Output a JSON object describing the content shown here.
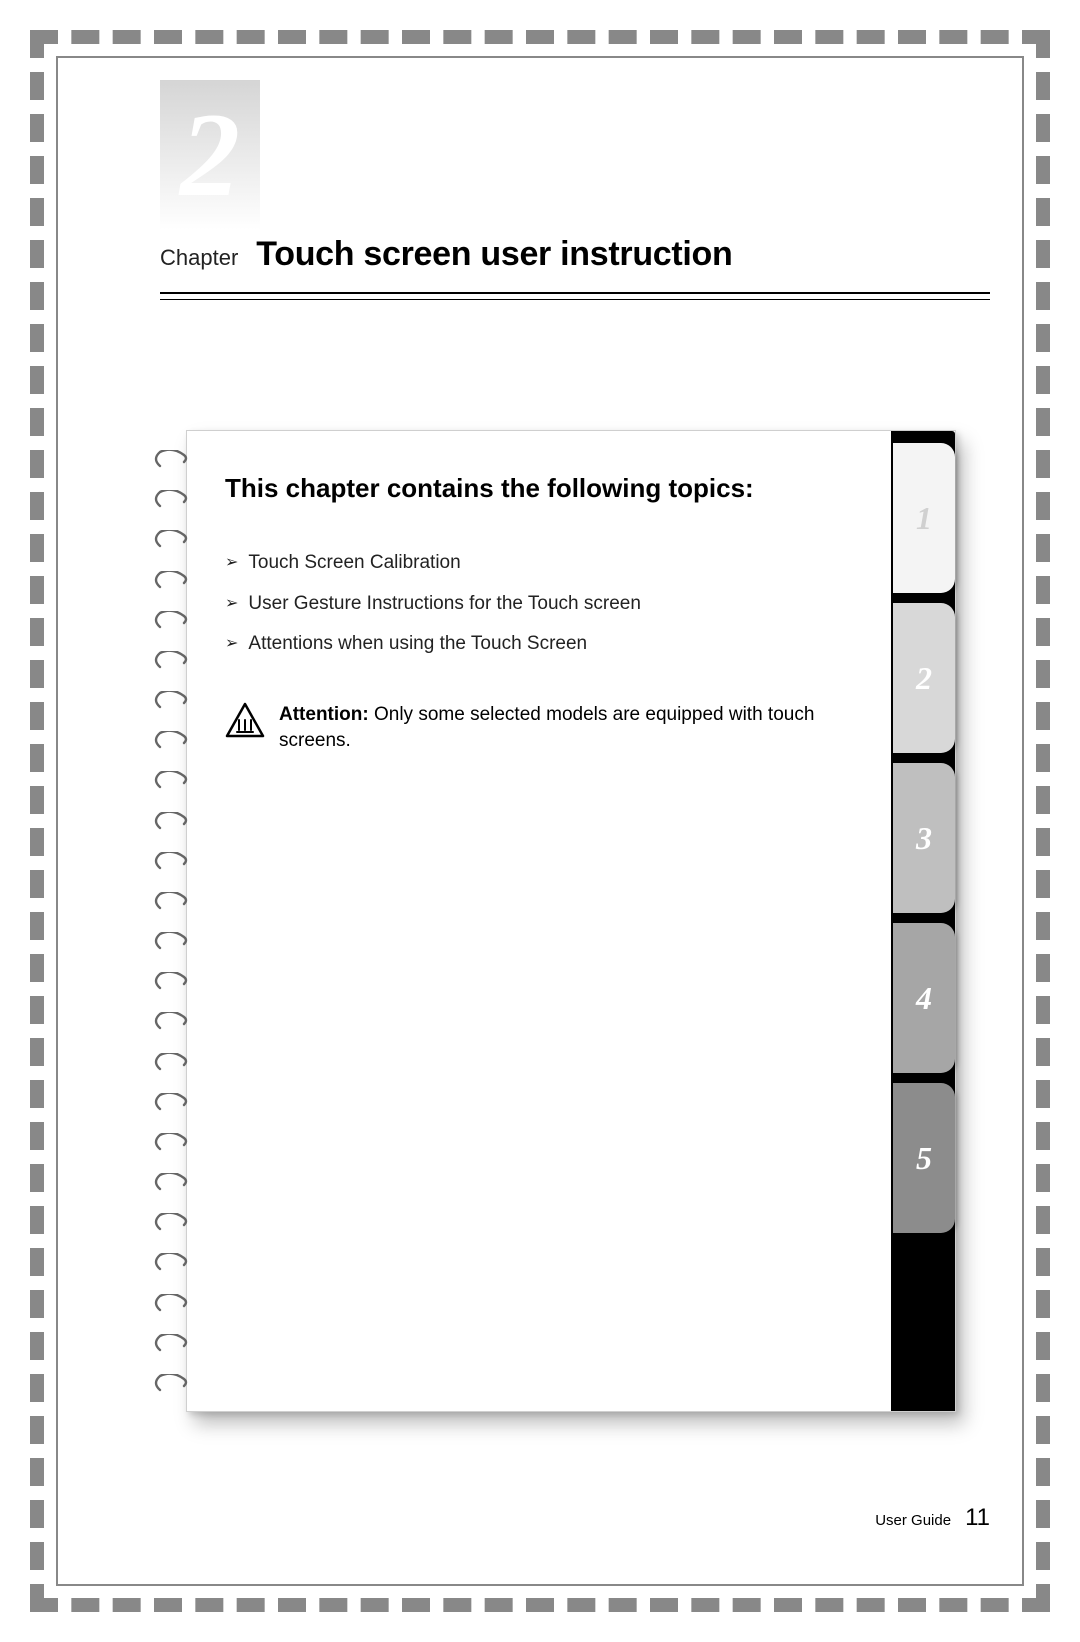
{
  "chapter": {
    "number": "2",
    "label": "Chapter",
    "title": "Touch screen user instruction"
  },
  "topics": {
    "heading": "This chapter contains the following topics:",
    "items": [
      "Touch Screen Calibration",
      "User Gesture Instructions for the Touch screen",
      "Attentions when using the Touch Screen"
    ]
  },
  "attention": {
    "label": "Attention:",
    "text": "Only some selected models are equipped with touch screens."
  },
  "tabs": [
    "1",
    "2",
    "3",
    "4",
    "5"
  ],
  "footer": {
    "label": "User Guide",
    "page": "11"
  }
}
